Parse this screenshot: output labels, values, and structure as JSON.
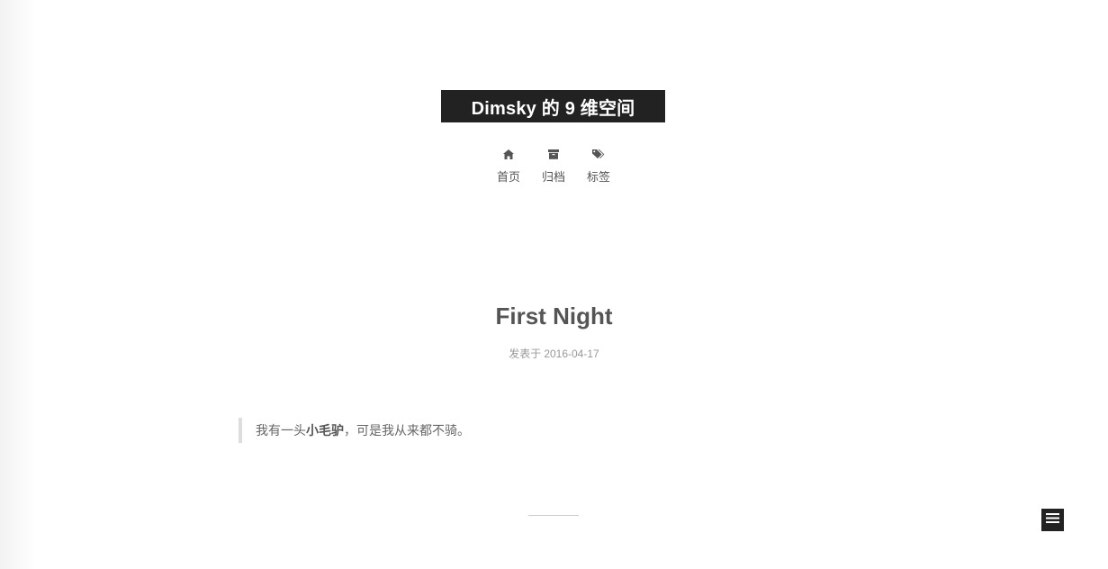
{
  "site": {
    "title": "Dimsky 的 9 维空间"
  },
  "menu": {
    "items": [
      {
        "label": "首页",
        "icon": "home-icon"
      },
      {
        "label": "归档",
        "icon": "archive-icon"
      },
      {
        "label": "标签",
        "icon": "tags-icon"
      }
    ]
  },
  "post": {
    "title": "First Night",
    "meta_prefix": "发表于",
    "date": "2016-04-17",
    "quote_before": "我有一头",
    "quote_bold": "小毛驴",
    "quote_after": "，可是我从来都不骑。"
  },
  "sidebar": {
    "toggle_icon": "menu-icon"
  },
  "colors": {
    "accent": "#222222",
    "text": "#555555",
    "meta": "#999999",
    "quote_border": "#dddddd"
  }
}
